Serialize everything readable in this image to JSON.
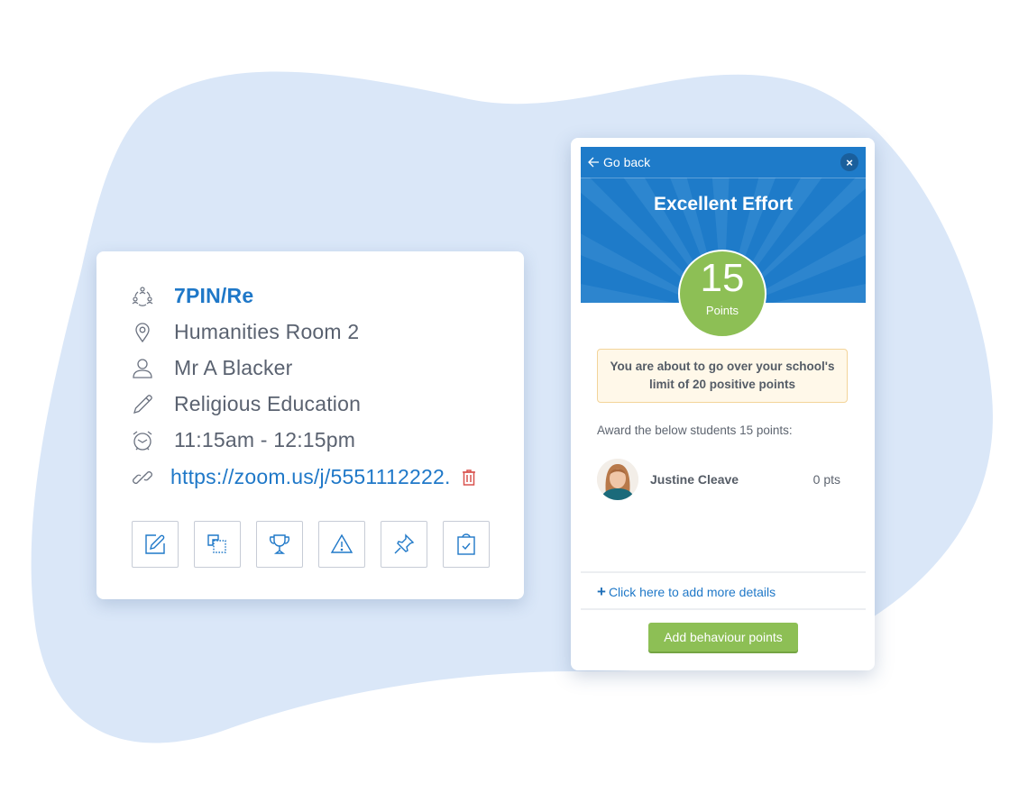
{
  "lesson_card": {
    "class_code": "7PIN/Re",
    "room": "Humanities Room 2",
    "teacher": "Mr A Blacker",
    "subject": "Religious Education",
    "time": "11:15am - 12:15pm",
    "link": "https://zoom.us/j/5551112222.",
    "icons": [
      "group-icon",
      "location-pin-icon",
      "person-icon",
      "pencil-icon",
      "alarm-clock-icon",
      "link-icon",
      "trash-icon"
    ],
    "toolbar": [
      {
        "name": "edit-button",
        "icon": "edit-icon"
      },
      {
        "name": "copy-button",
        "icon": "copy-icon"
      },
      {
        "name": "award-button",
        "icon": "trophy-icon"
      },
      {
        "name": "warning-button",
        "icon": "warning-icon"
      },
      {
        "name": "pin-button",
        "icon": "pin-icon"
      },
      {
        "name": "register-button",
        "icon": "clipboard-check-icon"
      }
    ],
    "colors": {
      "link": "#1f78c8",
      "delete": "#d9534f",
      "text": "#5a6270"
    }
  },
  "points_panel": {
    "go_back": "Go back",
    "close": "×",
    "title": "Excellent Effort",
    "points_value": "15",
    "points_label": "Points",
    "warning": "You are about to go over your school's limit of 20 positive points",
    "award_label": "Award the below students 15 points:",
    "students": [
      {
        "name": "Justine Cleave",
        "points": "0 pts"
      }
    ],
    "add_details": "Click here to add more details",
    "add_details_icon": "+",
    "submit": "Add behaviour points",
    "colors": {
      "header": "#1e7bc9",
      "green": "#8dbf55",
      "warning_bg": "#fff8e9",
      "warning_border": "#f3d49a"
    }
  }
}
